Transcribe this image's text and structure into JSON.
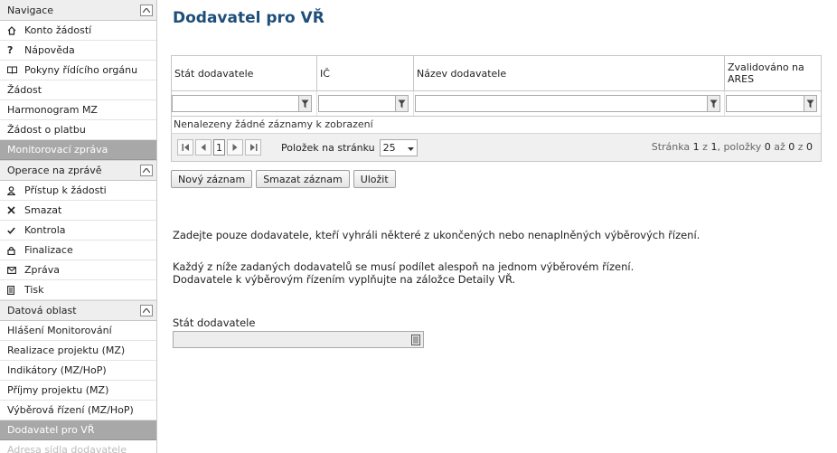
{
  "sidebar": {
    "sections": [
      {
        "title": "Navigace",
        "items": [
          {
            "label": "Konto žádostí",
            "icon": "home-icon"
          },
          {
            "label": "Nápověda",
            "icon": "help-icon"
          },
          {
            "label": "Pokyny řídícího orgánu",
            "icon": "book-icon"
          },
          {
            "label": "Žádost",
            "icon": ""
          },
          {
            "label": "Harmonogram MZ",
            "icon": ""
          },
          {
            "label": "Žádost o platbu",
            "icon": ""
          },
          {
            "label": "Monitorovací zpráva",
            "icon": "",
            "selected": true
          }
        ]
      },
      {
        "title": "Operace na zprávě",
        "items": [
          {
            "label": "Přístup k žádosti",
            "icon": "user-icon"
          },
          {
            "label": "Smazat",
            "icon": "close-icon"
          },
          {
            "label": "Kontrola",
            "icon": "check-icon"
          },
          {
            "label": "Finalizace",
            "icon": "lock-icon"
          },
          {
            "label": "Zpráva",
            "icon": "mail-icon"
          },
          {
            "label": "Tisk",
            "icon": "print-icon"
          }
        ]
      },
      {
        "title": "Datová oblast",
        "items": [
          {
            "label": "Hlášení Monitorování",
            "icon": ""
          },
          {
            "label": "Realizace projektu (MZ)",
            "icon": ""
          },
          {
            "label": "Indikátory (MZ/HoP)",
            "icon": ""
          },
          {
            "label": "Příjmy projektu (MZ)",
            "icon": ""
          },
          {
            "label": "Výběrová řízení (MZ/HoP)",
            "icon": ""
          },
          {
            "label": "Dodavatel pro VŘ",
            "icon": "",
            "selected": true
          },
          {
            "label": "Adresa sídla dodavatele",
            "icon": "",
            "faded": true
          }
        ]
      }
    ]
  },
  "main": {
    "title": "Dodavatel pro VŘ",
    "grid": {
      "columns": [
        "Stát dodavatele",
        "IČ",
        "Název dodavatele",
        "Zvalidováno na ARES"
      ],
      "no_records": "Nenalezeny žádné záznamy k zobrazení",
      "pager": {
        "current_page": "1",
        "per_page_label": "Položek na stránku",
        "per_page_value": "25",
        "info_prefix": "Stránka ",
        "info_page": "1",
        "info_of": " z ",
        "info_pages": "1",
        "info_items": ", položky ",
        "info_from": "0",
        "info_to_word": " až ",
        "info_to": "0",
        "info_total_word": " z ",
        "info_total": "0"
      }
    },
    "buttons": {
      "new": "Nový záznam",
      "delete": "Smazat záznam",
      "save": "Uložit"
    },
    "note1": "Zadejte pouze dodavatele, kteří vyhráli některé z ukončených nebo nenaplněných výběrových řízení.",
    "note2_line1": "Každý z níže zadaných dodavatelů se musí podílet alespoň na jednom výběrovém řízení.",
    "note2_line2": "Dodavatele k výběrovým řízením vyplňujte na záložce Detaily VŘ.",
    "field": {
      "label": "Stát dodavatele",
      "value": ""
    }
  }
}
